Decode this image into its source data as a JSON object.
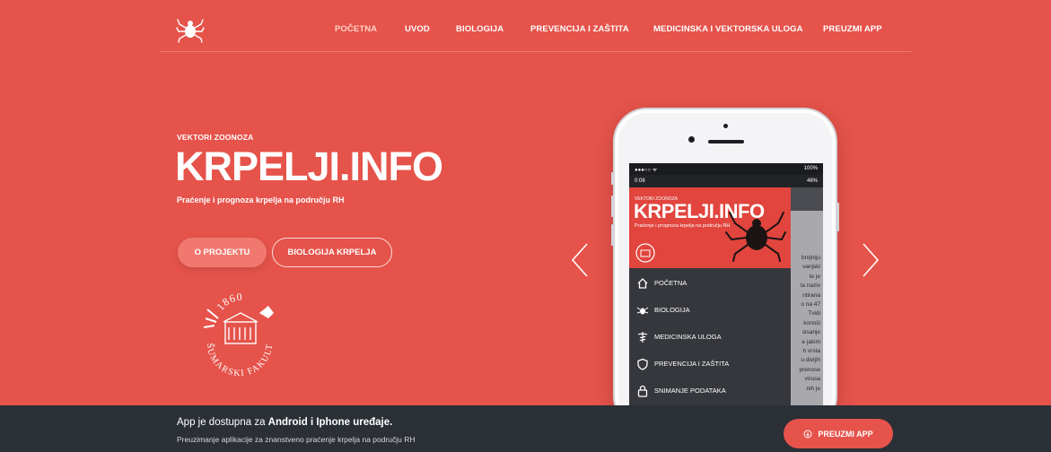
{
  "nav": {
    "items": [
      {
        "label": "POČETNA",
        "active": true
      },
      {
        "label": "UVOD"
      },
      {
        "label": "BIOLOGIJA"
      },
      {
        "label": "PREVENCIJA I ZAŠTITA"
      },
      {
        "label": "MEDICINSKA I VEKTORSKA ULOGA"
      },
      {
        "label": "PREUZMI APP"
      }
    ],
    "logo_icon": "tick-icon"
  },
  "hero": {
    "eyebrow": "VEKTORI ZOONOZA",
    "brand": "KRPELJI.INFO",
    "tagline": "Praćenje i prognoza krpelja na području RH",
    "primary_button": "O PROJEKTU",
    "secondary_button": "BIOLOGIJA KRPELJA",
    "seal_year": "1860",
    "seal_text": "ŠUMARSKI FAKULTET"
  },
  "phone": {
    "status_time": "0:08",
    "status_battery": "100%",
    "status_right2": "46%",
    "drawer_eyebrow": "VEKTORI ZOONOZA",
    "drawer_brand": "KRPELJI.INFO",
    "drawer_tagline": "Praćenje i prognoza krpelja na području RH",
    "menu": [
      {
        "label": "POČETNA",
        "icon": "home-icon"
      },
      {
        "label": "BIOLOGIJA",
        "icon": "tick-icon"
      },
      {
        "label": "MEDICINSKA ULOGA",
        "icon": "caduceus-icon"
      },
      {
        "label": "PREVENCIJA I ZAŠTITA",
        "icon": "shield-icon"
      },
      {
        "label": "SNIMANJE PODATAKA",
        "icon": "lock-icon"
      }
    ],
    "content_lines": [
      "brojniju",
      "vanjski",
      "te je",
      "la naziv",
      "ntirana",
      "o na 47",
      "Tvidi",
      "konoši",
      "sisanje",
      "e jakim",
      "h vrsta",
      "u divljih",
      "prenose",
      "virusa",
      "nih je"
    ]
  },
  "footer": {
    "title_prefix": "App je dostupna za ",
    "title_bold": "Android i Iphone uređaje.",
    "subtitle": "Preuzimanje aplikacije za znanstveno praćenje krpelja na području RH",
    "button": "PREUZMI APP"
  },
  "colors": {
    "accent": "#e5534b",
    "footer_bg": "#2b2f36",
    "button_light": "#f0786f"
  }
}
